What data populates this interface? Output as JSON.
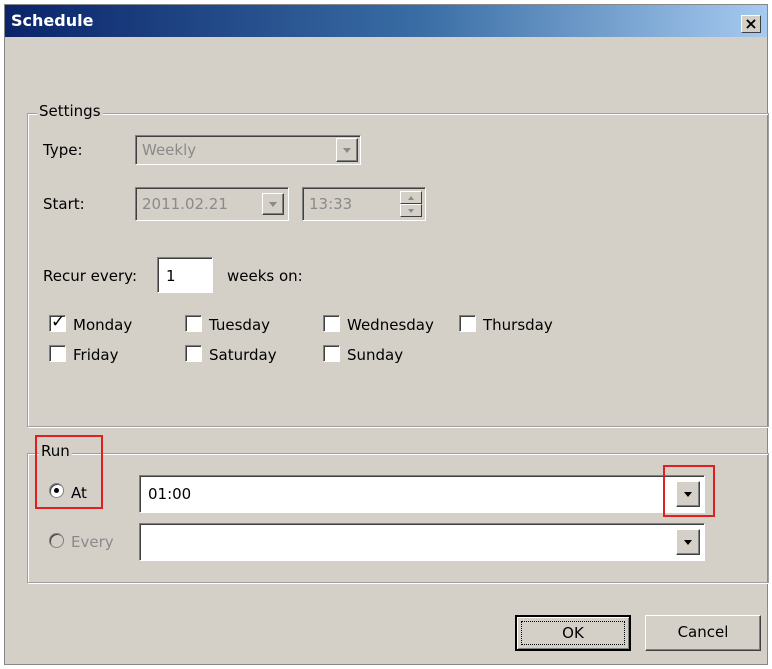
{
  "window": {
    "title": "Schedule",
    "close_glyph": "×"
  },
  "settings": {
    "legend": "Settings",
    "type_label": "Type:",
    "type_value": "Weekly",
    "start_label": "Start:",
    "start_date": "2011.02.21",
    "start_time": "13:33",
    "recur_label": "Recur every:",
    "recur_value": "1",
    "recur_suffix": "weeks on:",
    "days": [
      {
        "label": "Monday",
        "checked": true
      },
      {
        "label": "Tuesday",
        "checked": false
      },
      {
        "label": "Wednesday",
        "checked": false
      },
      {
        "label": "Thursday",
        "checked": false
      },
      {
        "label": "Friday",
        "checked": false
      },
      {
        "label": "Saturday",
        "checked": false
      },
      {
        "label": "Sunday",
        "checked": false
      }
    ]
  },
  "run": {
    "legend": "Run",
    "at_label": "At",
    "at_selected": true,
    "at_value": "01:00",
    "every_label": "Every",
    "every_value": ""
  },
  "buttons": {
    "ok": "OK",
    "cancel": "Cancel"
  },
  "icons": {
    "dropdown": "chevron-down-icon",
    "checkmark": "checkmark-icon",
    "close": "close-icon"
  },
  "colors": {
    "highlight": "#e02020",
    "titlebar_start": "#0a246a",
    "titlebar_end": "#a6caf0"
  }
}
